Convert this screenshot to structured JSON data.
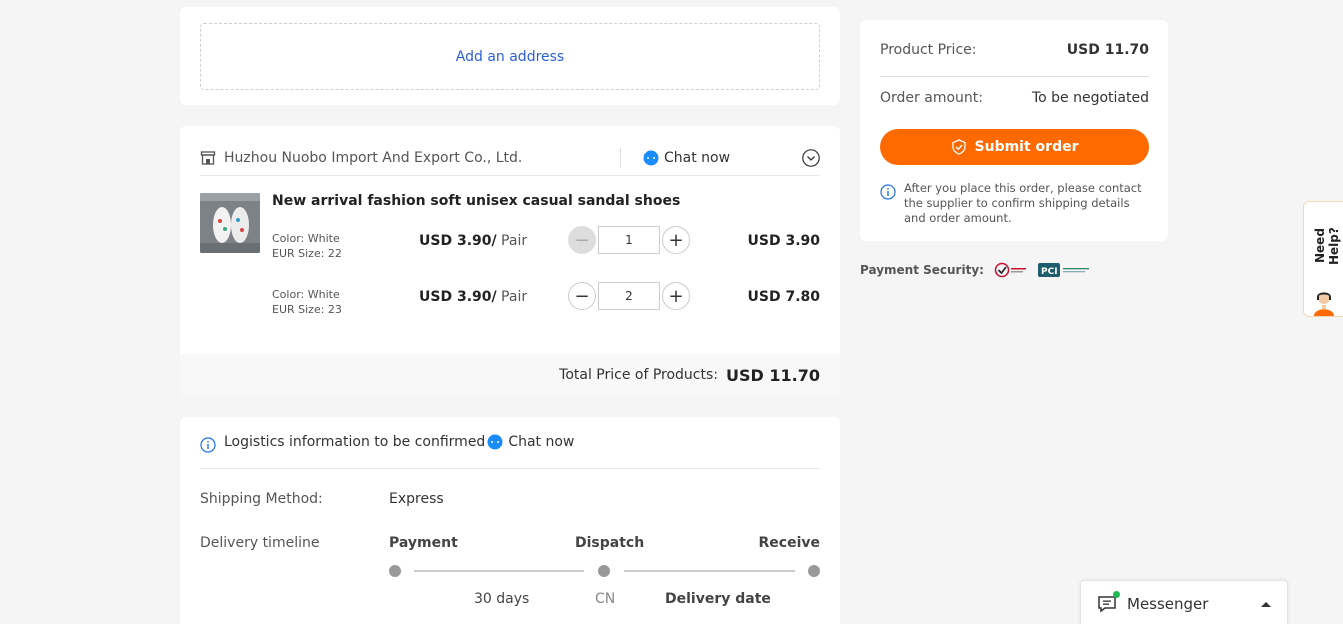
{
  "address": {
    "add_label": "Add an address"
  },
  "supplier": {
    "name": "Huzhou Nuobo Import And Export Co., Ltd.",
    "chat_label": "Chat now"
  },
  "product": {
    "title": "New arrival fashion soft unisex casual sandal shoes",
    "skus": [
      {
        "color": "Color: White",
        "size": "EUR Size: 22",
        "price": "USD 3.90/",
        "unit": " Pair",
        "qty": "1",
        "total": "USD 3.90"
      },
      {
        "color": "Color: White",
        "size": "EUR Size: 23",
        "price": "USD 3.90/",
        "unit": " Pair",
        "qty": "2",
        "total": "USD 7.80"
      }
    ],
    "total_label": "Total Price of Products:",
    "total_value": "USD 11.70"
  },
  "logistics": {
    "header": "Logistics information to be confirmed",
    "chat_label": "Chat now",
    "shipping_method_label": "Shipping Method:",
    "shipping_method_value": "Express",
    "delivery_timeline_label": "Delivery timeline",
    "steps": [
      "Payment",
      "Dispatch",
      "Receive"
    ],
    "payment_to_dispatch": "30 days",
    "dispatch_from": "CN",
    "delivery_date_label": "Delivery date"
  },
  "summary": {
    "product_price_label": "Product Price:",
    "product_price_value": "USD 11.70",
    "order_amount_label": "Order amount:",
    "order_amount_value": "To be negotiated",
    "submit_label": "Submit order",
    "note": "After you place this order, please contact the supplier to confirm shipping details and order amount."
  },
  "payment_security": {
    "label": "Payment Security:"
  },
  "help": {
    "label": "Need Help?"
  },
  "messenger": {
    "label": "Messenger"
  },
  "colors": {
    "accent": "#ff6a00",
    "link": "#2c5fd8",
    "info": "#1a73e8"
  }
}
